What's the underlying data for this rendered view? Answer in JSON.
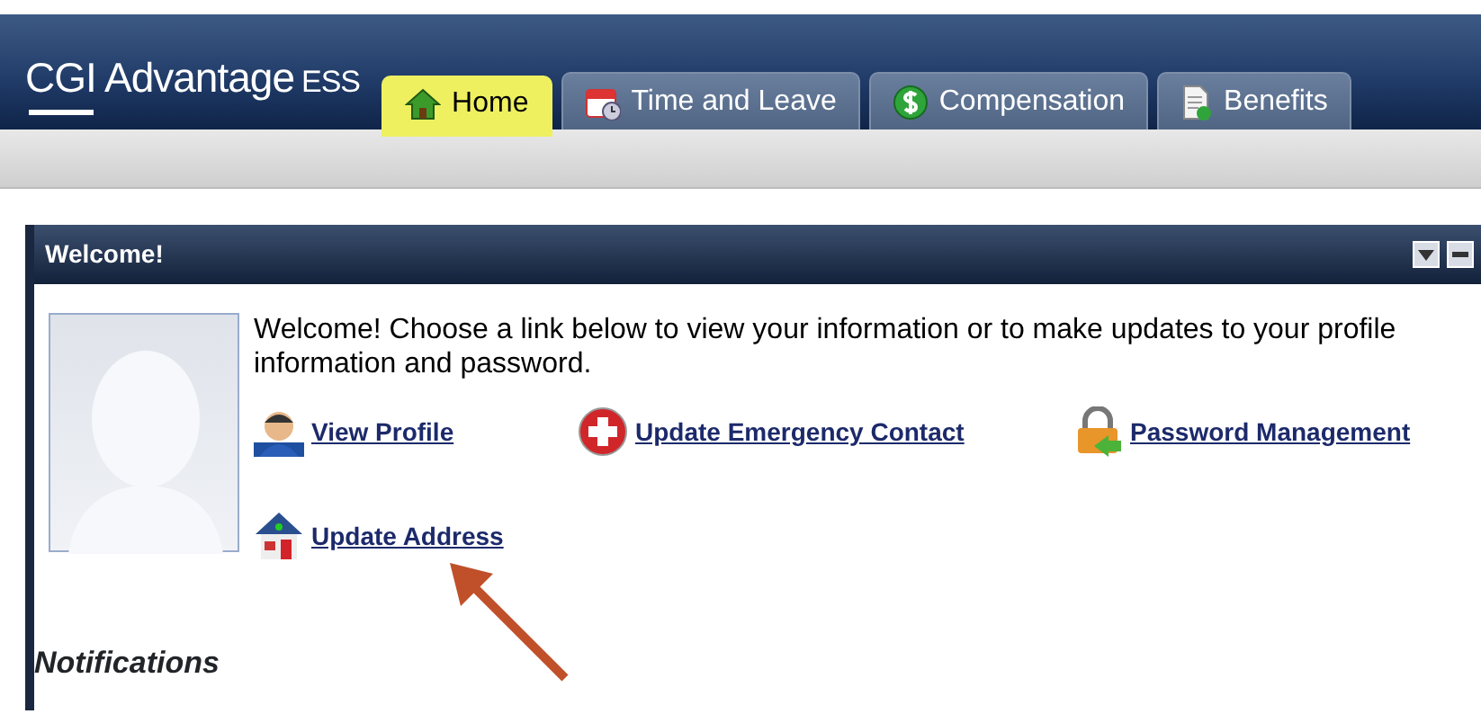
{
  "header": {
    "logo": "CGI Advantage",
    "logo_suffix": "ESS"
  },
  "tabs": [
    {
      "label": "Home",
      "selected": true
    },
    {
      "label": "Time and Leave",
      "selected": false
    },
    {
      "label": "Compensation",
      "selected": false
    },
    {
      "label": "Benefits",
      "selected": false
    }
  ],
  "panel": {
    "title": "Welcome!",
    "intro": "Welcome! Choose a link below to view your information or to make updates to your profile information and password.",
    "links": [
      {
        "label": "View Profile"
      },
      {
        "label": "Update Emergency Contact"
      },
      {
        "label": "Password Management"
      },
      {
        "label": "Update Address"
      }
    ],
    "notifications_heading": "Notifications"
  }
}
